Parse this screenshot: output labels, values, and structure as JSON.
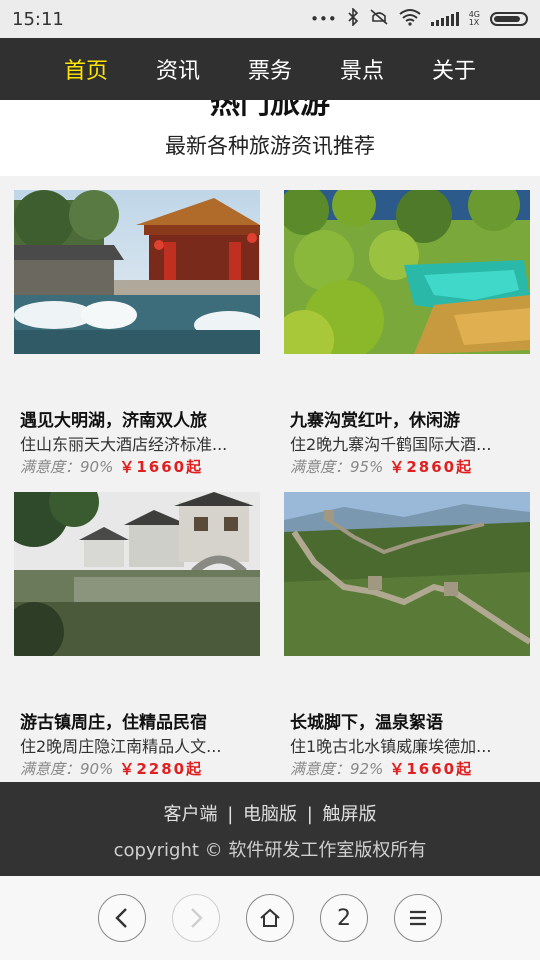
{
  "status_bar": {
    "time": "15:11",
    "icons": [
      "dots-icon",
      "bluetooth-icon",
      "mute-icon",
      "wifi-icon",
      "signal-icon",
      "battery-icon"
    ],
    "network_top": "4G",
    "network_bottom": "1X"
  },
  "nav": {
    "items": [
      {
        "label": "首页",
        "active": true
      },
      {
        "label": "资讯",
        "active": false
      },
      {
        "label": "票务",
        "active": false
      },
      {
        "label": "景点",
        "active": false
      },
      {
        "label": "关于",
        "active": false
      }
    ],
    "active_color": "#ffe600"
  },
  "hero": {
    "title": "热门旅游",
    "subtitle": "最新各种旅游资讯推荐"
  },
  "cards": [
    {
      "title": "遇见大明湖，济南双人旅",
      "desc": "住山东丽天大酒店经济标准...",
      "satisfaction": "满意度：90%",
      "price": "￥1660起"
    },
    {
      "title": "九寨沟赏红叶，休闲游",
      "desc": "住2晚九寨沟千鹤国际大酒...",
      "satisfaction": "满意度：95%",
      "price": "￥2860起"
    },
    {
      "title": "游古镇周庄，住精品民宿",
      "desc": "住2晚周庄隐江南精品人文...",
      "satisfaction": "满意度：90%",
      "price": "￥2280起"
    },
    {
      "title": "长城脚下，温泉絮语",
      "desc": "住1晚古北水镇威廉埃德加...",
      "satisfaction": "满意度：92%",
      "price": "￥1660起"
    }
  ],
  "footer": {
    "link1": "客户端",
    "link2": "电脑版",
    "link3": "触屏版",
    "sep": "|",
    "copyright": "copyright © 软件研发工作室版权所有"
  },
  "browser": {
    "tab_count": "2",
    "buttons": [
      "back-icon",
      "forward-icon",
      "home-icon",
      "tabs-button",
      "menu-icon"
    ]
  },
  "colors": {
    "price": "#e02020",
    "nav_bg": "#303030",
    "footer_bg": "#333333"
  }
}
